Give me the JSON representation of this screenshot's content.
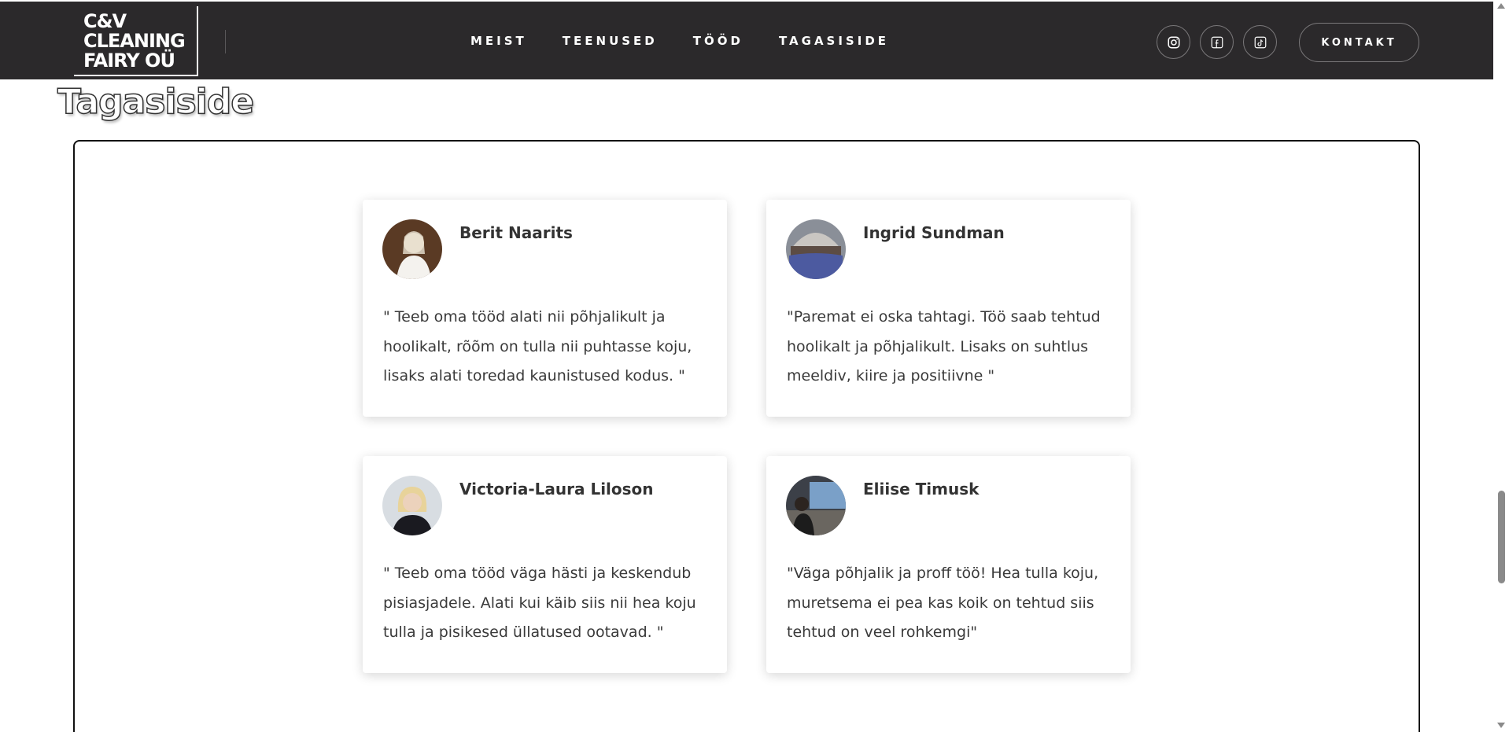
{
  "header": {
    "logo_lines": [
      "C&V",
      "CLEANING",
      "FAIRY OÜ"
    ],
    "nav": [
      {
        "label": "MEIST",
        "active": false
      },
      {
        "label": "TEENUSED",
        "active": false
      },
      {
        "label": "TÖÖD",
        "active": false
      },
      {
        "label": "TAGASISIDE",
        "active": true
      }
    ],
    "social_icons": [
      "instagram-icon",
      "facebook-icon",
      "tiktok-icon"
    ],
    "contact_label": "KONTAKT"
  },
  "page": {
    "title": "Tagasiside"
  },
  "testimonials": [
    {
      "name": "Berit Naarits",
      "quote": "\" Teeb oma tööd alati nii põhjalikult ja hoolikalt, rõõm on tulla nii puhtasse koju, lisaks alati toredad kaunistused kodus. \"",
      "avatar": "avatar-photo"
    },
    {
      "name": "Ingrid Sundman",
      "quote": "\"Paremat ei oska tahtagi. Töö saab tehtud hoolikalt ja põhjalikult. Lisaks on suhtlus meeldiv, kiire ja positiivne \"",
      "avatar": "avatar-photo"
    },
    {
      "name": "Victoria-Laura Liloson",
      "quote": "\" Teeb oma tööd väga hästi ja keskendub pisiasjadele. Alati kui käib siis nii hea koju tulla ja pisikesed üllatused ootavad. \"",
      "avatar": "avatar-photo"
    },
    {
      "name": "Eliise Timusk",
      "quote": "\"Väga põhjalik ja proff töö! Hea tulla koju, muretsema ei pea kas koik on tehtud siis tehtud on veel rohkemgi\"",
      "avatar": "avatar-photo"
    }
  ],
  "colors": {
    "header_bg": "#2b292b",
    "text": "#333333",
    "card_bg": "#ffffff"
  }
}
